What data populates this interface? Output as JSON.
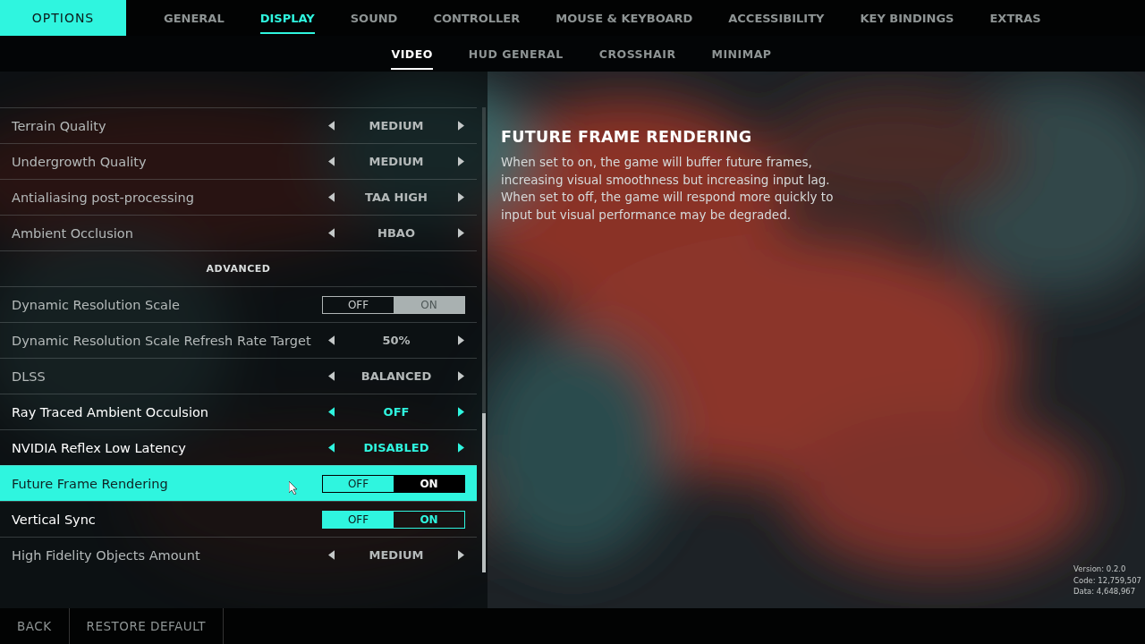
{
  "header": {
    "title": "OPTIONS"
  },
  "tabs": [
    {
      "label": "GENERAL",
      "selected": false
    },
    {
      "label": "DISPLAY",
      "selected": true
    },
    {
      "label": "SOUND",
      "selected": false
    },
    {
      "label": "CONTROLLER",
      "selected": false
    },
    {
      "label": "MOUSE & KEYBOARD",
      "selected": false
    },
    {
      "label": "ACCESSIBILITY",
      "selected": false
    },
    {
      "label": "KEY BINDINGS",
      "selected": false
    },
    {
      "label": "EXTRAS",
      "selected": false
    }
  ],
  "subtabs": [
    {
      "label": "VIDEO",
      "selected": true
    },
    {
      "label": "HUD GENERAL",
      "selected": false
    },
    {
      "label": "CROSSHAIR",
      "selected": false
    },
    {
      "label": "MINIMAP",
      "selected": false
    }
  ],
  "settings": [
    {
      "kind": "selector",
      "label": "Terrain Quality",
      "value": "MEDIUM",
      "changed": false,
      "selected": false
    },
    {
      "kind": "selector",
      "label": "Undergrowth Quality",
      "value": "MEDIUM",
      "changed": false,
      "selected": false
    },
    {
      "kind": "selector",
      "label": "Antialiasing post-processing",
      "value": "TAA HIGH",
      "changed": false,
      "selected": false
    },
    {
      "kind": "selector",
      "label": "Ambient Occlusion",
      "value": "HBAO",
      "changed": false,
      "selected": false
    },
    {
      "kind": "section",
      "label": "ADVANCED"
    },
    {
      "kind": "toggle",
      "label": "Dynamic Resolution Scale",
      "off_label": "OFF",
      "on_label": "ON",
      "on": true,
      "changed": false,
      "selected": false
    },
    {
      "kind": "selector",
      "label": "Dynamic Resolution Scale Refresh Rate Target",
      "value": "50%",
      "changed": false,
      "selected": false
    },
    {
      "kind": "selector",
      "label": "DLSS",
      "value": "BALANCED",
      "changed": false,
      "selected": false
    },
    {
      "kind": "selector",
      "label": "Ray Traced Ambient Occulsion",
      "value": "OFF",
      "changed": true,
      "selected": false
    },
    {
      "kind": "selector",
      "label": "NVIDIA Reflex Low Latency",
      "value": "DISABLED",
      "changed": true,
      "selected": false
    },
    {
      "kind": "toggle",
      "label": "Future Frame Rendering",
      "off_label": "OFF",
      "on_label": "ON",
      "on": true,
      "changed": true,
      "selected": true
    },
    {
      "kind": "toggle",
      "label": "Vertical Sync",
      "off_label": "OFF",
      "on_label": "ON",
      "on": false,
      "changed": true,
      "selected": false
    },
    {
      "kind": "selector",
      "label": "High Fidelity Objects Amount",
      "value": "MEDIUM",
      "changed": false,
      "selected": false
    }
  ],
  "description": {
    "title": "FUTURE FRAME RENDERING",
    "text": "When set to on, the game will buffer future frames, increasing visual smoothness but increasing input lag. When set to off, the game will respond more quickly to input but visual performance may be degraded."
  },
  "build_info": [
    "Version: 0.2.0",
    "Code: 12,759,507",
    "Data: 4,648,967"
  ],
  "footer": [
    {
      "label": "BACK"
    },
    {
      "label": "RESTORE DEFAULT"
    }
  ]
}
